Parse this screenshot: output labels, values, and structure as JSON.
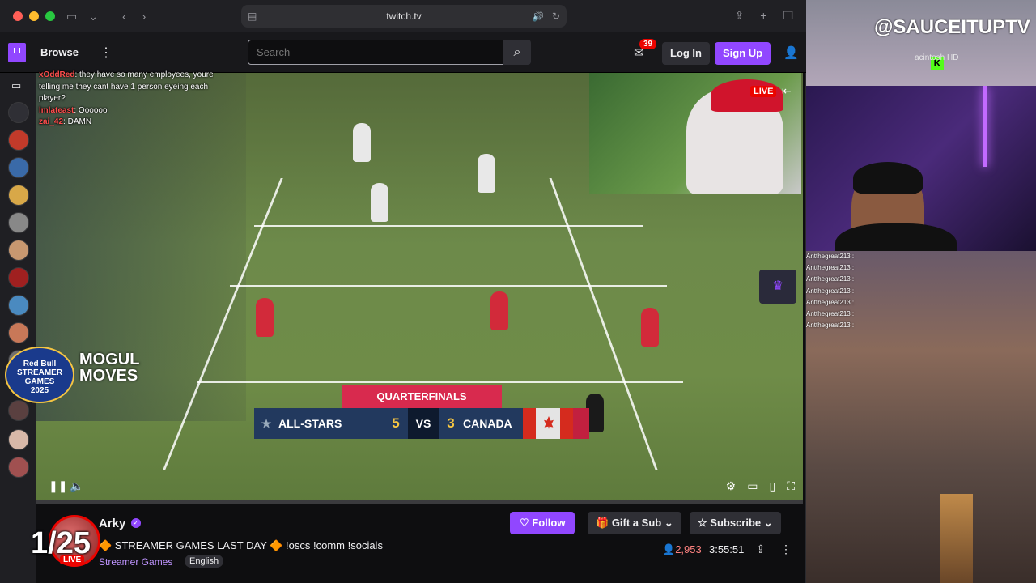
{
  "browser": {
    "url": "twitch.tv"
  },
  "nav": {
    "browse": "Browse",
    "search_placeholder": "Search",
    "notifications_count": "39",
    "login": "Log In",
    "signup": "Sign Up"
  },
  "video_overlay": {
    "chat": [
      {
        "user": "xOddRed",
        "text": "they have so many employees, youre telling me they cant have 1 person eyeing each player?"
      },
      {
        "user": "lmlateast",
        "text": "Oooooo"
      },
      {
        "user": "zai_42",
        "text": "DAMN"
      }
    ],
    "pip_live": "LIVE",
    "scoreboard": {
      "round": "QUARTERFINALS",
      "team1": "ALL-STARS",
      "score1": "5",
      "vs": "VS",
      "score2": "3",
      "team2": "CANADA"
    },
    "event_logo_line1": "Red Bull",
    "event_logo_line2": "STREAMER GAMES",
    "event_logo_year": "2025",
    "event_name": "MOGUL MOVES"
  },
  "channel": {
    "name": "Arky",
    "live": "LIVE",
    "title": "🔶 STREAMER GAMES LAST DAY 🔶 !oscs !comm !socials",
    "category": "Streamer Games",
    "language": "English",
    "follow": "Follow",
    "gift": "Gift a Sub",
    "subscribe": "Subscribe",
    "viewers": "2,953",
    "uptime": "3:55:51"
  },
  "stream_overlay": {
    "handle": "@SAUCEITUPTV",
    "desk_label": "acintosh HD",
    "counter": "1/25",
    "mini_chat": [
      "Antthegreat213 :",
      "Antthegreat213 :",
      "Antthegreat213 :",
      "Antthegreat213 :",
      "Antthegreat213 :",
      "Antthegreat213 :",
      "Antthegreat213 :"
    ]
  },
  "colors": {
    "twitch_purple": "#9147ff",
    "live_red": "#eb0400"
  }
}
